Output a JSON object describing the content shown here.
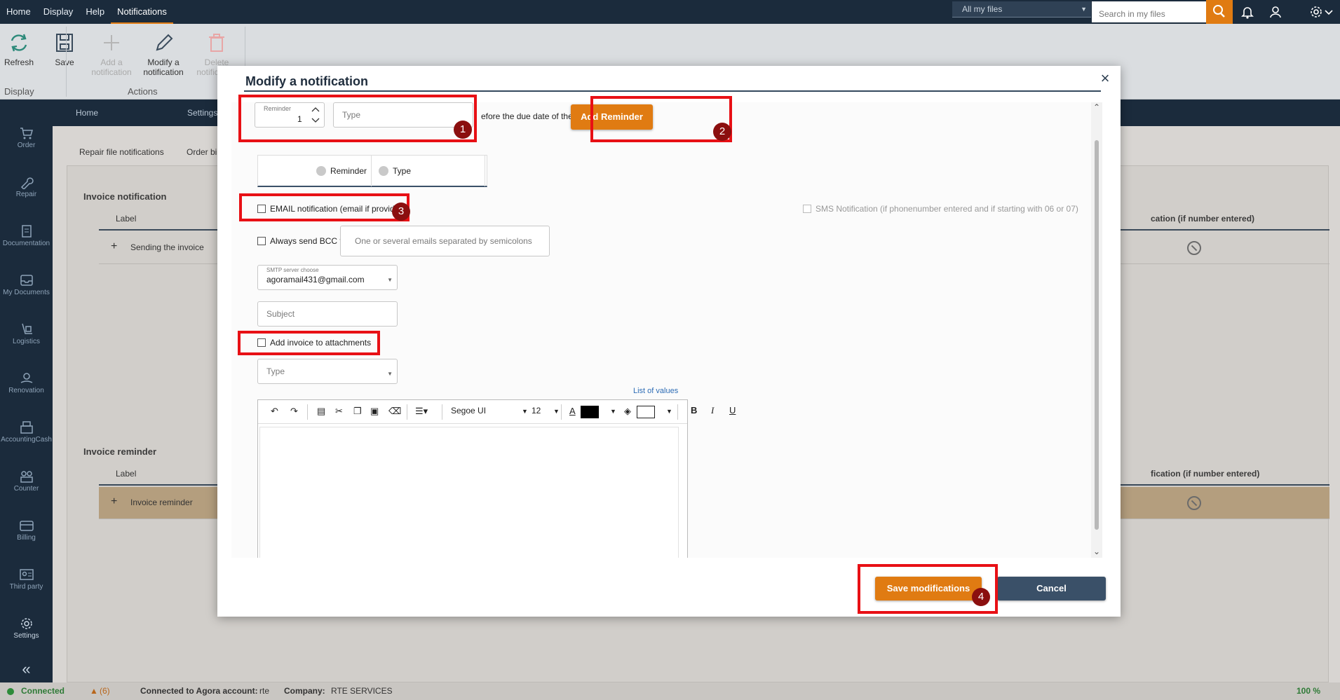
{
  "topbar": {
    "menu": [
      "Home",
      "Display",
      "Help",
      "Notifications"
    ],
    "active_menu": "Notifications",
    "file_filter": "All my files",
    "search_placeholder": "Search in my files"
  },
  "ribbon": {
    "refresh": "Refresh",
    "save": "Save",
    "add_notification": "Add a notification",
    "modify_notification": "Modify a notification",
    "delete_notification": "Delete notification",
    "group_display": "Display",
    "group_actions": "Actions"
  },
  "sidebar": {
    "items": [
      "Order",
      "Repair",
      "Documentation",
      "My Documents",
      "Logistics",
      "Renovation",
      "AccountingCash",
      "Counter",
      "Billing",
      "Third party",
      "Settings"
    ]
  },
  "subnav": {
    "home": "Home",
    "settings": "Settings"
  },
  "background": {
    "tabs": [
      "Repair file notifications",
      "Order bi"
    ],
    "invoice_notification_title": "Invoice notification",
    "label_col": "Label",
    "sms_col_1": "cation (if number entered)",
    "row_1": "Sending the invoice",
    "invoice_reminder_title": "Invoice reminder",
    "label_col_2": "Label",
    "sms_col_2": "fication (if number entered)",
    "row_2": "Invoice reminder"
  },
  "modal": {
    "title": "Modify a notification",
    "reminder_label": "Reminder",
    "reminder_value": "1",
    "type_placeholder": "Type",
    "before_due_text": "efore the due date of the invoice",
    "add_reminder_button": "Add Reminder",
    "grid_col_reminder": "Reminder",
    "grid_col_type": "Type",
    "email_notification": "EMAIL notification (email if provided)",
    "sms_notification": "SMS Notification (if phonenumber entered and if starting with 06 or 07)",
    "always_bcc": "Always send BCC to",
    "bcc_placeholder": "One or several emails separated by semicolons",
    "smtp_label": "SMTP server choose",
    "smtp_value": "agoramail431@gmail.com",
    "subject_placeholder": "Subject",
    "add_invoice_attachments": "Add invoice to attachments",
    "type2_placeholder": "Type",
    "list_of_values": "List of values",
    "font_name": "Segoe UI",
    "font_size": "12",
    "save_button": "Save modifications",
    "cancel_button": "Cancel"
  },
  "annotations": [
    "1",
    "2",
    "3",
    "4"
  ],
  "statusbar": {
    "connected": "Connected",
    "warnings": "(6)",
    "account_label": "Connected to Agora account:",
    "account_value": "rte",
    "company_label": "Company:",
    "company_value": "RTE SERVICES",
    "zoom": "100 %"
  },
  "colors": {
    "accent": "#e07b12",
    "navy": "#1b2b3c",
    "annotation_red": "#e81015"
  }
}
